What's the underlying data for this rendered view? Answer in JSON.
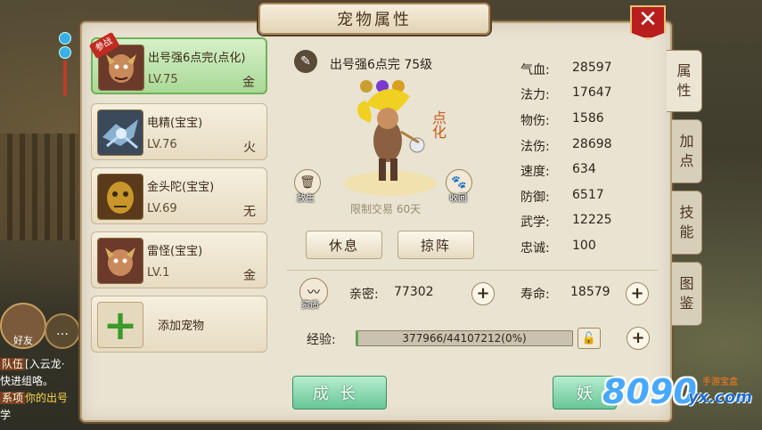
{
  "panel": {
    "title": "宠物属性"
  },
  "close_symbol": "✕",
  "pets": [
    {
      "name": "出号强6点完(点化)",
      "level": "LV.75",
      "element": "金",
      "battle_badge": "参战",
      "active": true
    },
    {
      "name": "电精(宝宝)",
      "level": "LV.76",
      "element": "火"
    },
    {
      "name": "金头陀(宝宝)",
      "level": "LV.69",
      "element": "无"
    },
    {
      "name": "雷怪(宝宝)",
      "level": "LV.1",
      "element": "金"
    }
  ],
  "add_pet_label": "添加宠物",
  "center": {
    "title": "出号强6点完 75级",
    "dianhua": "点化",
    "release_label": "放生",
    "recall_label": "收回",
    "trade_limit": "限制交易 60天",
    "rest_button": "休息",
    "formation_button": "掠阵"
  },
  "stats": [
    {
      "key": "气血:",
      "value": "28597"
    },
    {
      "key": "法力:",
      "value": "17647"
    },
    {
      "key": "物伤:",
      "value": "1586"
    },
    {
      "key": "法伤:",
      "value": "28698"
    },
    {
      "key": "速度:",
      "value": "634"
    },
    {
      "key": "防御:",
      "value": "6517"
    },
    {
      "key": "武学:",
      "value": "12225"
    },
    {
      "key": "忠诚:",
      "value": "100"
    }
  ],
  "side_tabs": [
    "属性",
    "加点",
    "技能",
    "图鉴"
  ],
  "intimacy": {
    "label": "亲密:",
    "value": "77302"
  },
  "lifespan": {
    "label": "寿命:",
    "value": "18579"
  },
  "aptitude_label": "资质",
  "experience": {
    "label": "经验:",
    "text": "377966/44107212(0%)",
    "fraction": 0.0086
  },
  "growth_button": "成长",
  "demon_button": "妖",
  "watermark": {
    "big": "8090",
    "small": "yx.com",
    "top": "手游宝盒"
  },
  "chat": {
    "bubble_label": "好友",
    "lines": [
      {
        "tag": "队伍",
        "text": "[入云龙·"
      },
      {
        "tag": "",
        "text": "快进组咯。"
      },
      {
        "tag": "系项",
        "text": "你的出号"
      },
      {
        "tag": "",
        "text": "学"
      }
    ]
  },
  "colors": {
    "active_card": "#a9d996",
    "accent_green": "#66c697",
    "close_red": "#b81e1e"
  }
}
